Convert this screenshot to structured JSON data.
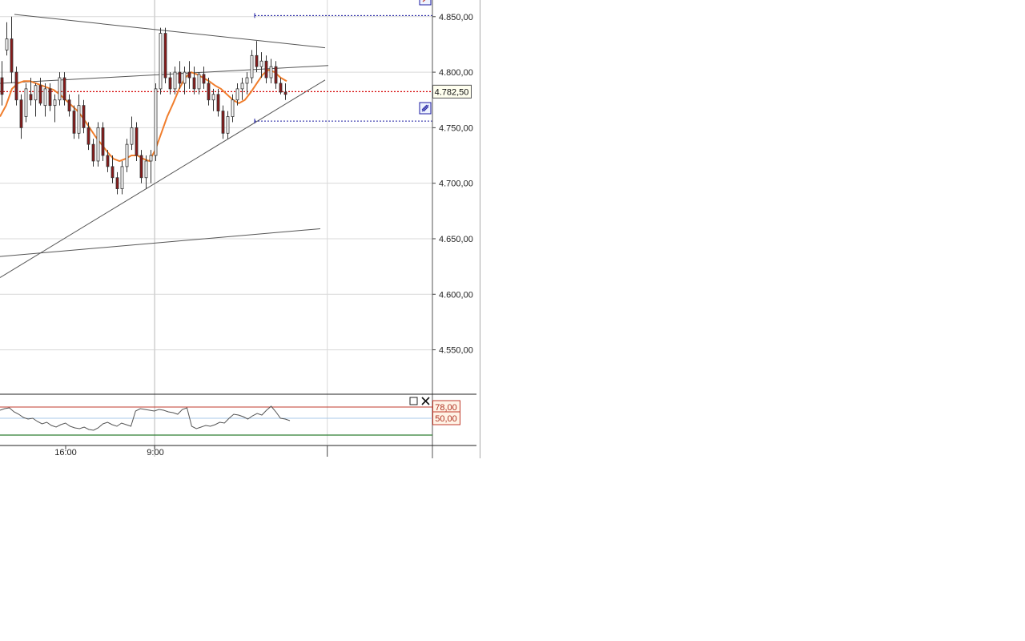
{
  "colors": {
    "grid": "#d9d9d9",
    "candle_up": "#ffffff",
    "candle_down": "#8b1a1a",
    "candle_edge": "#333333",
    "ma_line": "#f07d2c",
    "trendline": "#555555",
    "price_line": "#d40000",
    "target_line": "#1a1aa0",
    "osc_line": "#555555",
    "osc_upper": "#c0392b",
    "osc_lower": "#2e7d32",
    "osc_mid": "#a8c8e8",
    "tag_border": "#c0392b",
    "tag_bg": "#fff3e6"
  },
  "icons": {
    "chart_maximize": "square-icon",
    "chart_close": "close-icon",
    "drawing_handle": "drawing-tool-icon"
  },
  "price_tag": "4.782,50",
  "osc_tags": {
    "upper": "78,00",
    "mid": "50,00"
  },
  "chart_data": {
    "type": "candlestick",
    "price_axis": {
      "range": [
        4510,
        4865
      ],
      "ticks": [
        4850,
        4800,
        4750,
        4700,
        4650,
        4600,
        4550
      ],
      "tick_labels": [
        "4.850,00",
        "4.800,00",
        "4.750,00",
        "4.700,00",
        "4.650,00",
        "4.600,00",
        "4.550,00"
      ],
      "grid": true
    },
    "time_axis": {
      "tick_labels": [
        "16:00",
        "9:00"
      ],
      "tick_bar_index": [
        14,
        39
      ],
      "session_break_bar_index": 39,
      "extra_gridline_bar_index": 83
    },
    "last_price": 4782.5,
    "candles": [
      [
        4795,
        4810,
        4770,
        4780
      ],
      [
        4820,
        4845,
        4815,
        4830
      ],
      [
        4830,
        4850,
        4790,
        4800
      ],
      [
        4800,
        4805,
        4770,
        4775
      ],
      [
        4775,
        4780,
        4740,
        4750
      ],
      [
        4760,
        4790,
        4755,
        4785
      ],
      [
        4780,
        4795,
        4770,
        4775
      ],
      [
        4775,
        4790,
        4760,
        4788
      ],
      [
        4788,
        4795,
        4770,
        4772
      ],
      [
        4770,
        4790,
        4760,
        4785
      ],
      [
        4785,
        4790,
        4765,
        4770
      ],
      [
        4770,
        4780,
        4755,
        4775
      ],
      [
        4775,
        4800,
        4770,
        4795
      ],
      [
        4795,
        4800,
        4770,
        4775
      ],
      [
        4775,
        4780,
        4760,
        4765
      ],
      [
        4765,
        4770,
        4740,
        4745
      ],
      [
        4745,
        4780,
        4740,
        4770
      ],
      [
        4770,
        4775,
        4745,
        4750
      ],
      [
        4750,
        4755,
        4730,
        4735
      ],
      [
        4735,
        4740,
        4715,
        4720
      ],
      [
        4720,
        4755,
        4715,
        4750
      ],
      [
        4750,
        4755,
        4720,
        4725
      ],
      [
        4725,
        4730,
        4710,
        4715
      ],
      [
        4715,
        4725,
        4700,
        4705
      ],
      [
        4705,
        4710,
        4690,
        4695
      ],
      [
        4695,
        4720,
        4690,
        4715
      ],
      [
        4715,
        4740,
        4710,
        4735
      ],
      [
        4735,
        4760,
        4730,
        4750
      ],
      [
        4750,
        4755,
        4720,
        4725
      ],
      [
        4725,
        4730,
        4700,
        4705
      ],
      [
        4705,
        4725,
        4695,
        4720
      ],
      [
        4720,
        4730,
        4700,
        4725
      ],
      [
        4725,
        4790,
        4720,
        4785
      ],
      [
        4785,
        4840,
        4780,
        4835
      ],
      [
        4835,
        4840,
        4790,
        4795
      ],
      [
        4795,
        4800,
        4780,
        4785
      ],
      [
        4785,
        4805,
        4780,
        4800
      ],
      [
        4800,
        4810,
        4785,
        4790
      ],
      [
        4790,
        4805,
        4780,
        4800
      ],
      [
        4800,
        4810,
        4785,
        4795
      ],
      [
        4795,
        4805,
        4780,
        4785
      ],
      [
        4785,
        4800,
        4780,
        4798
      ],
      [
        4798,
        4805,
        4785,
        4790
      ],
      [
        4790,
        4795,
        4770,
        4775
      ],
      [
        4775,
        4785,
        4765,
        4780
      ],
      [
        4780,
        4785,
        4760,
        4765
      ],
      [
        4765,
        4770,
        4740,
        4745
      ],
      [
        4745,
        4765,
        4740,
        4760
      ],
      [
        4760,
        4780,
        4755,
        4775
      ],
      [
        4775,
        4790,
        4770,
        4785
      ],
      [
        4785,
        4795,
        4775,
        4790
      ],
      [
        4790,
        4800,
        4780,
        4795
      ],
      [
        4795,
        4820,
        4790,
        4815
      ],
      [
        4815,
        4828,
        4800,
        4805
      ],
      [
        4805,
        4818,
        4795,
        4810
      ],
      [
        4810,
        4815,
        4790,
        4795
      ],
      [
        4795,
        4812,
        4790,
        4805
      ],
      [
        4805,
        4810,
        4785,
        4790
      ],
      [
        4790,
        4795,
        4780,
        4782
      ],
      [
        4782,
        4790,
        4775,
        4780
      ]
    ],
    "moving_average": [
      4760,
      4770,
      4785,
      4790,
      4792,
      4792,
      4790,
      4788,
      4786,
      4784,
      4780,
      4775,
      4770,
      4765,
      4758,
      4750,
      4742,
      4735,
      4728,
      4722,
      4720,
      4722,
      4725,
      4725,
      4722,
      4720,
      4730,
      4745,
      4760,
      4772,
      4785,
      4795,
      4800,
      4798,
      4795,
      4792,
      4788,
      4785,
      4780,
      4775,
      4772,
      4775,
      4782,
      4790,
      4798,
      4802,
      4800,
      4795,
      4792
    ],
    "oscillator": {
      "range": [
        0,
        100
      ],
      "upper_level": 78,
      "mid_level": 50,
      "lower_level": 8,
      "values": [
        70,
        74,
        76,
        66,
        60,
        52,
        48,
        50,
        42,
        36,
        40,
        32,
        28,
        34,
        38,
        30,
        26,
        24,
        28,
        22,
        20,
        26,
        36,
        40,
        34,
        30,
        38,
        34,
        30,
        68,
        74,
        72,
        70,
        68,
        72,
        70,
        66,
        64,
        60,
        72,
        76,
        30,
        24,
        28,
        32,
        30,
        34,
        40,
        38,
        50,
        60,
        58,
        54,
        48,
        56,
        62,
        58,
        70,
        80,
        66,
        50,
        48,
        44
      ]
    }
  }
}
